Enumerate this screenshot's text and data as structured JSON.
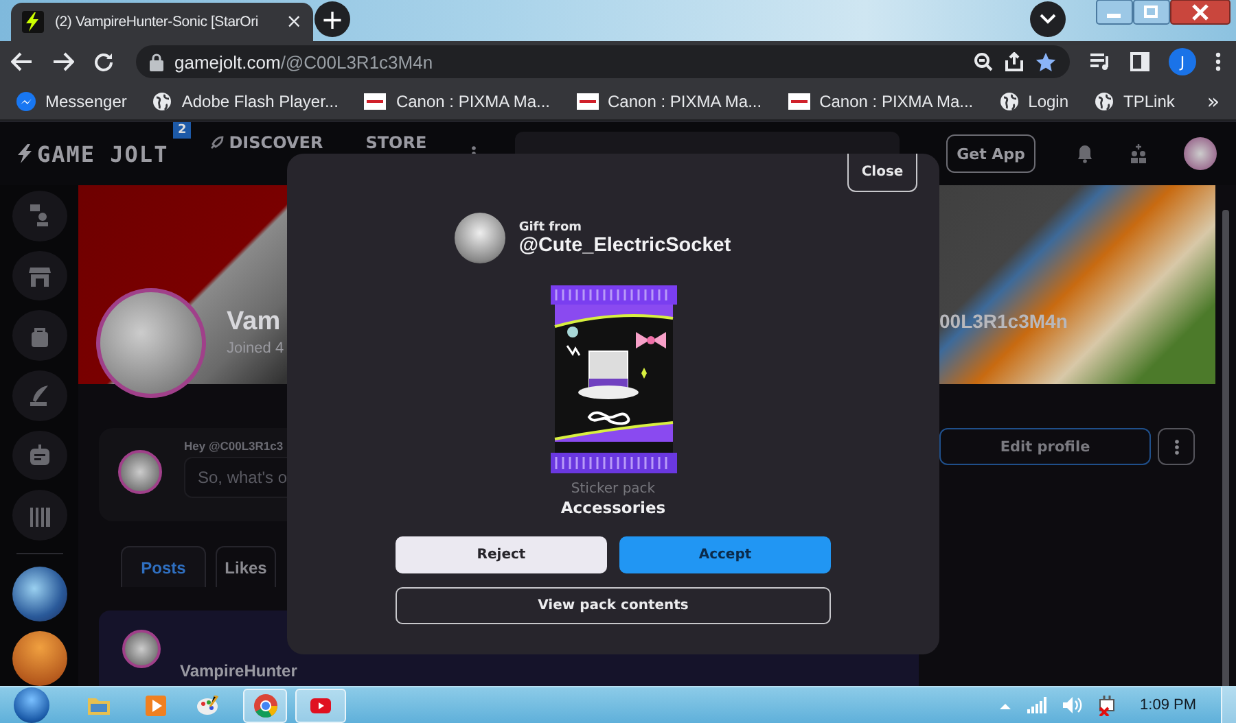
{
  "browser": {
    "tab": {
      "title": "(2) VampireHunter-Sonic [StarOri",
      "close": "×"
    },
    "new_tab": "+",
    "url": {
      "host": "gamejolt.com",
      "path": "/@C00L3R1c3M4n"
    },
    "profile_initial": "J",
    "bookmarks": [
      {
        "label": "Messenger",
        "kind": "messenger"
      },
      {
        "label": "Adobe Flash Player...",
        "kind": "globe"
      },
      {
        "label": "Canon : PIXMA Ma...",
        "kind": "canon"
      },
      {
        "label": "Canon : PIXMA Ma...",
        "kind": "canon"
      },
      {
        "label": "Canon : PIXMA Ma...",
        "kind": "canon"
      },
      {
        "label": "Login",
        "kind": "globe"
      },
      {
        "label": "TPLink",
        "kind": "globe"
      }
    ],
    "bookmarks_more": "»"
  },
  "site": {
    "logo": "GAME JOLT",
    "notification_count": "2",
    "nav": [
      "DISCOVER",
      "STORE"
    ],
    "get_app": "Get App"
  },
  "profile": {
    "name": "Vam",
    "joined": "Joined 4",
    "handle": "00L3R1c3M4n",
    "edit": "Edit profile"
  },
  "composer": {
    "label": "Hey @C00L3R1c3",
    "placeholder": "So, what's o"
  },
  "tabs": [
    {
      "label": "Posts",
      "selected": true
    },
    {
      "label": "Likes",
      "selected": false
    }
  ],
  "post": {
    "author": "VampireHunter"
  },
  "modal": {
    "close": "Close",
    "gift_label": "Gift from",
    "sender": "@Cute_ElectricSocket",
    "item_type": "Sticker pack",
    "item_name": "Accessories",
    "buttons": [
      {
        "label": "Reject",
        "kind": "secondary"
      },
      {
        "label": "Accept",
        "kind": "primary"
      },
      {
        "label": "View pack contents",
        "kind": "outline"
      }
    ]
  },
  "taskbar": {
    "clock": "1:09 PM"
  }
}
